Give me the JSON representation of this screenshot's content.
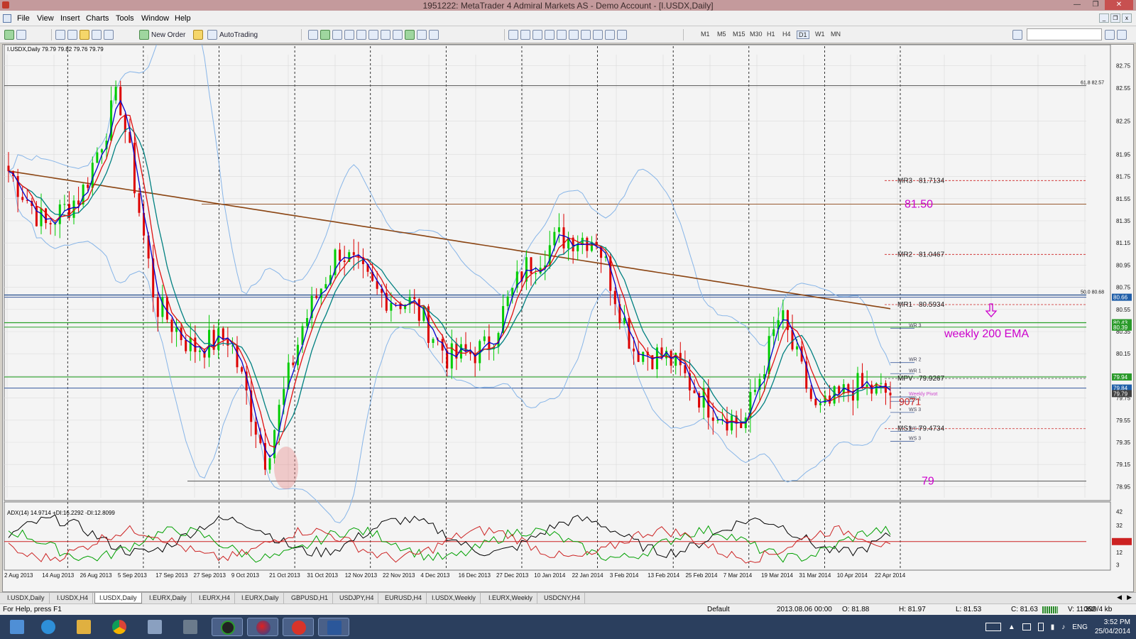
{
  "window": {
    "title": "1951222: MetaTrader 4 Admiral Markets AS - Demo Account - [I.USDX,Daily]"
  },
  "menu": [
    "File",
    "View",
    "Insert",
    "Charts",
    "Tools",
    "Window",
    "Help"
  ],
  "toolbar": {
    "new_order": "New Order",
    "autotrading": "AutoTrading",
    "timeframes": [
      "M1",
      "M5",
      "M15",
      "M30",
      "H1",
      "H4",
      "D1",
      "W1",
      "MN"
    ]
  },
  "colors": {
    "bull": "#00cc00",
    "bear": "#dd0000",
    "fast_ma": "#0000cc",
    "mid_ma": "#008080",
    "slow_ma": "#e01010",
    "ema200": "#8b4513",
    "bands": "#87b5e8",
    "annotation": "#cc00cc",
    "adx": "#000000",
    "plus_di": "#00a000",
    "minus_di": "#cc2222"
  },
  "chart": {
    "header": "I.USDX,Daily  79.79 79.82 79.76 79.79",
    "ohlc_current": "79.79",
    "price_axis": [
      "82.75",
      "82.55",
      "82.25",
      "81.95",
      "81.75",
      "81.55",
      "81.35",
      "81.15",
      "80.95",
      "80.75",
      "80.55",
      "80.35",
      "80.15",
      "79.95",
      "79.75",
      "79.55",
      "79.35",
      "79.15",
      "78.95"
    ],
    "price_tags": [
      {
        "text": "80.66",
        "price": 80.66,
        "color": "#1f5ea8"
      },
      {
        "text": "80.43",
        "price": 80.43,
        "color": "#2a9a2a"
      },
      {
        "text": "80.39",
        "price": 80.39,
        "color": "#2a9a2a"
      },
      {
        "text": "79.94",
        "price": 79.94,
        "color": "#2a9a2a"
      },
      {
        "text": "79.84",
        "price": 79.84,
        "color": "#1f5ea8"
      },
      {
        "text": "79.79",
        "price": 79.79,
        "color": "#404040"
      }
    ],
    "date_axis": [
      "2 Aug 2013",
      "14 Aug 2013",
      "26 Aug 2013",
      "5 Sep 2013",
      "17 Sep 2013",
      "27 Sep 2013",
      "9 Oct 2013",
      "21 Oct 2013",
      "31 Oct 2013",
      "12 Nov 2013",
      "22 Nov 2013",
      "4 Dec 2013",
      "16 Dec 2013",
      "27 Dec 2013",
      "10 Jan 2014",
      "22 Jan 2014",
      "3 Feb 2014",
      "13 Feb 2014",
      "25 Feb 2014",
      "7 Mar 2014",
      "19 Mar 2014",
      "31 Mar 2014",
      "10 Apr 2014",
      "22 Apr 2014"
    ],
    "fib_labels": [
      {
        "text": "61.8  82.57",
        "price": 82.57
      },
      {
        "text": "50.0  80.68",
        "price": 80.68
      }
    ],
    "pivots": [
      {
        "label": "MR3",
        "value": "81.7134",
        "price": 81.7134
      },
      {
        "label": "MR2",
        "value": "81.0467",
        "price": 81.0467
      },
      {
        "label": "MR1",
        "value": "80.5934",
        "price": 80.5934
      },
      {
        "label": "MPV",
        "value": "79.9267",
        "price": 79.9267
      },
      {
        "label": "MS1",
        "value": "79.4734",
        "price": 79.4734
      }
    ],
    "weekly_levels": [
      {
        "label": "WR 3",
        "price": 80.38
      },
      {
        "label": "WR 2",
        "price": 80.07
      },
      {
        "label": "WR 1",
        "price": 79.97
      },
      {
        "label": "Weekly Pivot",
        "price": 79.76
      },
      {
        "label": "WS 1",
        "price": 79.72
      },
      {
        "label": "WS 3",
        "price": 79.62
      },
      {
        "label": "WS 2",
        "price": 79.45
      },
      {
        "label": "WS 3",
        "price": 79.36
      }
    ],
    "annotations": {
      "level_high": "81.50",
      "level_low": "79",
      "ema_note": "weekly 200 EMA",
      "side_note": "9071"
    },
    "indicator": {
      "header": "ADX(14) 14.9714 +DI:16.2292 -DI:12.8099",
      "axis": [
        "42",
        "32",
        "20.00",
        "12",
        "3"
      ]
    }
  },
  "chart_data": {
    "type": "candlestick",
    "instrument": "I.USDX",
    "timeframe": "Daily",
    "ylim": [
      78.85,
      82.85
    ],
    "x_range": [
      "2 Aug 2013",
      "25 Apr 2014"
    ],
    "levels": [
      {
        "label": "MR3",
        "value": 81.7134
      },
      {
        "label": "MR2",
        "value": 81.0467
      },
      {
        "label": "MR1",
        "value": 80.5934
      },
      {
        "label": "MPV",
        "value": 79.9267
      },
      {
        "label": "MS1",
        "value": 79.4734
      },
      {
        "label": "81.50",
        "value": 81.5
      },
      {
        "label": "79",
        "value": 79.0
      }
    ],
    "anchor_closes": [
      [
        "2 Aug 2013",
        81.8
      ],
      [
        "14 Aug 2013",
        81.3
      ],
      [
        "26 Aug 2013",
        81.6
      ],
      [
        "5 Sep 2013",
        82.5
      ],
      [
        "17 Sep 2013",
        80.6
      ],
      [
        "27 Sep 2013",
        80.2
      ],
      [
        "9 Oct 2013",
        80.3
      ],
      [
        "21 Oct 2013",
        79.2
      ],
      [
        "31 Oct 2013",
        80.4
      ],
      [
        "12 Nov 2013",
        81.1
      ],
      [
        "22 Nov 2013",
        80.7
      ],
      [
        "4 Dec 2013",
        80.6
      ],
      [
        "16 Dec 2013",
        80.1
      ],
      [
        "27 Dec 2013",
        80.2
      ],
      [
        "10 Jan 2014",
        80.9
      ],
      [
        "22 Jan 2014",
        81.2
      ],
      [
        "3 Feb 2014",
        81.2
      ],
      [
        "13 Feb 2014",
        80.2
      ],
      [
        "25 Feb 2014",
        80.1
      ],
      [
        "7 Mar 2014",
        79.7
      ],
      [
        "19 Mar 2014",
        79.5
      ],
      [
        "31 Mar 2014",
        80.5
      ],
      [
        "10 Apr 2014",
        79.6
      ],
      [
        "22 Apr 2014",
        79.85
      ],
      [
        "25 Apr 2014",
        79.79
      ]
    ],
    "indicator": {
      "name": "ADX(14)",
      "adx": 14.9714,
      "plus_di": 16.2292,
      "minus_di": 12.8099,
      "level": 20.0,
      "ylim": [
        0,
        45
      ]
    }
  },
  "tabs": [
    "I.USDX,Daily",
    "I.USDX,H4",
    "I.USDX,Daily",
    "I.EURX,Daily",
    "I.EURX,H4",
    "I.EURX,Daily",
    "GBPUSD,H1",
    "USDJPY,H4",
    "EURUSD,H4",
    "I.USDX,Weekly",
    "I.EURX,Weekly",
    "USDCNY,H4"
  ],
  "active_tab": 2,
  "status": {
    "help": "For Help, press F1",
    "profile": "Default",
    "datetime": "2013.08.06 00:00",
    "open": "O: 81.88",
    "high": "H: 81.97",
    "low": "L: 81.53",
    "close": "C: 81.63",
    "volume": "V: 11062",
    "traffic": "399/4 kb"
  },
  "taskbar": {
    "lang": "ENG",
    "time": "3:52 PM",
    "date": "25/04/2014"
  }
}
